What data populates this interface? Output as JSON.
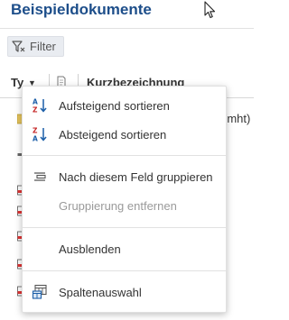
{
  "page": {
    "title": "Beispieldokumente",
    "filter_label": "Filter"
  },
  "table": {
    "columns": {
      "type": "Ty",
      "short_name": "Kurzbezeichnung"
    },
    "visible_cell_text": "(mht)"
  },
  "menu": {
    "items": [
      {
        "label": "Aufsteigend sortieren",
        "icon": "sort-ascending-icon",
        "enabled": true
      },
      {
        "label": "Absteigend sortieren",
        "icon": "sort-descending-icon",
        "enabled": true
      },
      {
        "label": "Nach diesem Feld gruppieren",
        "icon": "group-by-icon",
        "enabled": true
      },
      {
        "label": "Gruppierung entfernen",
        "icon": "",
        "enabled": false
      },
      {
        "label": "Ausblenden",
        "icon": "",
        "enabled": true
      },
      {
        "label": "Spaltenauswahl",
        "icon": "column-chooser-icon",
        "enabled": true
      }
    ]
  },
  "colors": {
    "title": "#1d4e8a",
    "sort_icon_blue": "#1b5ea8",
    "sort_icon_red": "#c62828"
  }
}
